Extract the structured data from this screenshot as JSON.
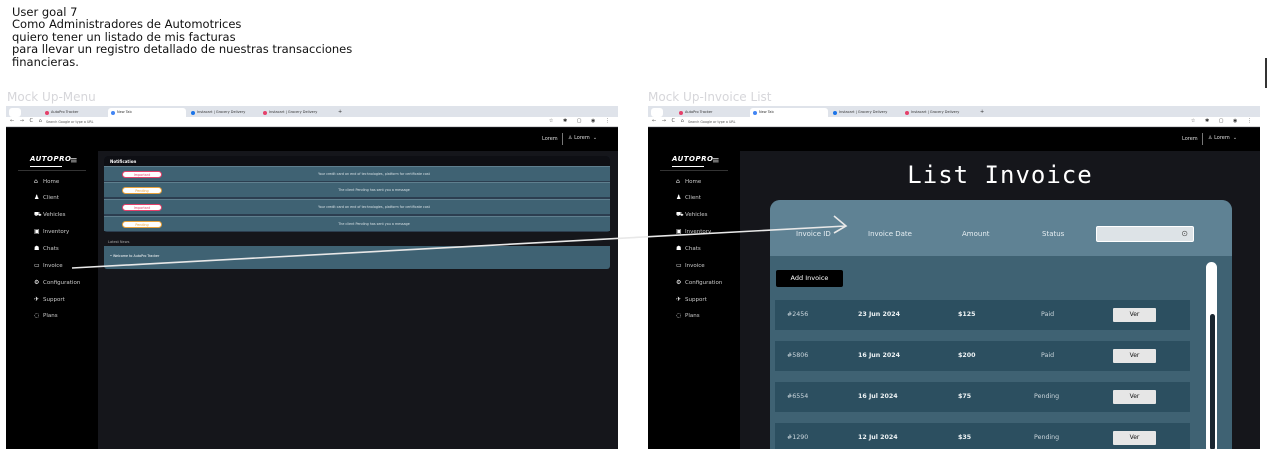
{
  "goal": {
    "lines": [
      "User goal 7",
      "Como Administradores de Automotrices",
      "quiero tener un listado de mis facturas",
      "para llevar un registro detallado de nuestras transacciones",
      "financieras."
    ]
  },
  "mockups": {
    "menu_title": "Mock Up-Menu",
    "invoice_title": "Mock Up-Invoice List"
  },
  "browser": {
    "tabs": [
      "AutoPro Tracker",
      "New Tab",
      "Instacart | Grocery Delivery",
      "Instacart | Grocery Delivery"
    ],
    "url": "Search Google or type a URL",
    "new_tab": "+"
  },
  "app": {
    "logo": "AUTOPRO",
    "top_link": "Lorem",
    "user": "Lorem",
    "sidebar": [
      "Home",
      "Client",
      "Vehicles",
      "Inventory",
      "Chats",
      "Invoice",
      "Configuration",
      "Support",
      "Plans"
    ],
    "icons": [
      "home-icon",
      "client-icon",
      "vehicles-icon",
      "inventory-icon",
      "chats-icon",
      "invoice-icon",
      "configuration-icon",
      "support-icon",
      "plans-icon"
    ]
  },
  "menu_page": {
    "notification_heading": "Notification",
    "notifications": [
      {
        "badge": "Important",
        "message": "Your credit card on end of technologies, platform for certificate cost"
      },
      {
        "badge": "Pending",
        "message": "The client Pending has sent you a message"
      },
      {
        "badge": "Important",
        "message": "Your credit card on end of technologies, platform for certificate cost"
      },
      {
        "badge": "Pending",
        "message": "The client Pending has sent you a message"
      }
    ],
    "news_heading": "Latest News",
    "news_item": "• Welcome to AutoPro Tracker"
  },
  "invoice_page": {
    "title": "List Invoice",
    "columns": [
      "Invoice ID",
      "Invoice Date",
      "Amount",
      "Status"
    ],
    "add_button": "Add Invoice",
    "view_button": "Ver",
    "rows": [
      {
        "id": "#2456",
        "date": "23 Jun 2024",
        "amount": "$125",
        "status": "Paid"
      },
      {
        "id": "#5806",
        "date": "16 Jun 2024",
        "amount": "$200",
        "status": "Paid"
      },
      {
        "id": "#6554",
        "date": "16 Jul 2024",
        "amount": "$75",
        "status": "Pending"
      },
      {
        "id": "#1290",
        "date": "12 Jul 2024",
        "amount": "$35",
        "status": "Pending"
      }
    ]
  },
  "colors": {
    "app_bg": "#15161b",
    "sidebar": "#000000",
    "card": "#3f6273",
    "card_header": "#5f8294",
    "row": "#2c4f60",
    "important": "#e4406a",
    "pending": "#e8a23c"
  }
}
